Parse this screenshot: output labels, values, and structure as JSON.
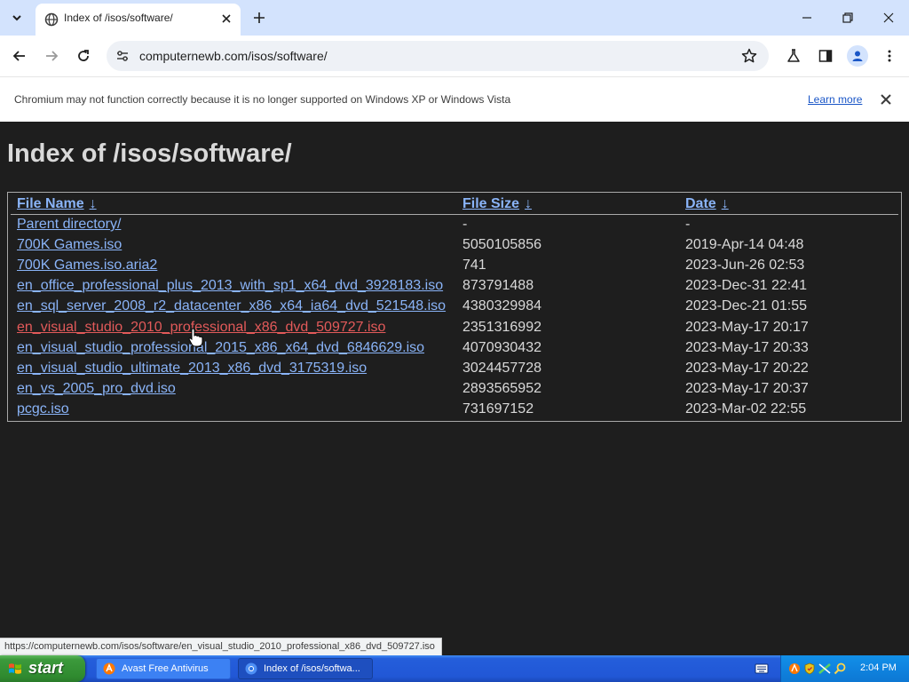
{
  "browser": {
    "tab": {
      "title": "Index of /isos/software/"
    },
    "url": "computernewb.com/isos/software/",
    "infobar": {
      "message": "Chromium may not function correctly because it is no longer supported on Windows XP or Windows Vista",
      "learn_more": "Learn more"
    },
    "status_url": "https://computernewb.com/isos/software/en_visual_studio_2010_professional_x86_dvd_509727.iso"
  },
  "page": {
    "heading": "Index of /isos/software/",
    "columns": {
      "name": "File Name",
      "size": "File Size",
      "date": "Date",
      "sort_arrow": "↓"
    },
    "rows": [
      {
        "name": "Parent directory/",
        "size": "-",
        "date": "-"
      },
      {
        "name": "700K Games.iso",
        "size": "5050105856",
        "date": "2019-Apr-14 04:48"
      },
      {
        "name": "700K Games.iso.aria2",
        "size": "741",
        "date": "2023-Jun-26 02:53"
      },
      {
        "name": "en_office_professional_plus_2013_with_sp1_x64_dvd_3928183.iso",
        "size": "873791488",
        "date": "2023-Dec-31 22:41"
      },
      {
        "name": "en_sql_server_2008_r2_datacenter_x86_x64_ia64_dvd_521548.iso",
        "size": "4380329984",
        "date": "2023-Dec-21 01:55"
      },
      {
        "name": "en_visual_studio_2010_professional_x86_dvd_509727.iso",
        "size": "2351316992",
        "date": "2023-May-17 20:17"
      },
      {
        "name": "en_visual_studio_professional_2015_x86_x64_dvd_6846629.iso",
        "size": "4070930432",
        "date": "2023-May-17 20:33"
      },
      {
        "name": "en_visual_studio_ultimate_2013_x86_dvd_3175319.iso",
        "size": "3024457728",
        "date": "2023-May-17 20:22"
      },
      {
        "name": "en_vs_2005_pro_dvd.iso",
        "size": "2893565952",
        "date": "2023-May-17 20:37"
      },
      {
        "name": "pcgc.iso",
        "size": "731697152",
        "date": "2023-Mar-02 22:55"
      }
    ]
  },
  "taskbar": {
    "start_label": "start",
    "tasks": [
      {
        "label": "Avast Free Antivirus",
        "icon": "avast-icon"
      },
      {
        "label": "Index of /isos/softwa...",
        "icon": "chromium-icon"
      }
    ],
    "clock": "2:04 PM"
  },
  "colors": {
    "link": "#8ab4f8",
    "link_hover": "#e35a5a",
    "page_bg": "#1e1e1e",
    "tab_strip": "#d3e3fd",
    "taskbar": "#245edb",
    "start_button": "#3c9a3c"
  }
}
